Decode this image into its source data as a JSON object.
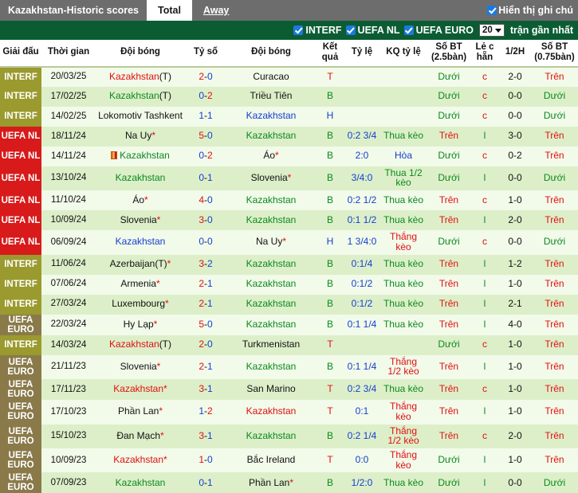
{
  "topbar": {
    "title_main": "Kazakhstan",
    "title_sep": " - ",
    "title_sub": "Historic scores",
    "tabs": [
      {
        "label": "Total",
        "active": true
      },
      {
        "label": "Away",
        "active": false
      }
    ],
    "show_notes_label": "Hiển thị ghi chú",
    "show_notes_checked": true
  },
  "filterbar": {
    "filters": [
      {
        "label": "INTERF",
        "checked": true
      },
      {
        "label": "UEFA NL",
        "checked": true
      },
      {
        "label": "UEFA EURO",
        "checked": true
      }
    ],
    "count_value": "20",
    "count_suffix": "trận gần nhất"
  },
  "columns": [
    "Giải đấu",
    "Thời gian",
    "Đội bóng",
    "Tỷ số",
    "Đội bóng",
    "Kết quả",
    "Tỷ lệ",
    "KQ tỷ lệ",
    "Số BT (2.5bàn)",
    "Lẻ c hẵn",
    "1/2H",
    "Số BT (0.75bàn)"
  ],
  "colors": {
    "interf_badge": "#9a9a2e",
    "uefa_nl_badge": "#d81a1a",
    "uefa_euro_badge": "#8a7a4a",
    "header_green": "#0b5c33",
    "topbar_gray": "#6d6d6d",
    "accent_blue": "#1a7ae0",
    "row_odd": "#f2faea",
    "row_even": "#ddefc9",
    "green_text": "#0a8a1e",
    "red_text": "#e01010",
    "blue_text": "#1540d0"
  },
  "rows": [
    {
      "league": "INTERF",
      "league_key": "interf",
      "time": "20/03/25",
      "home": "Kazakhstan",
      "home_color": "red",
      "home_suffix": "(T)",
      "home_card": false,
      "score_l": "2",
      "score_r": "0",
      "score_l_color": "red",
      "score_r_color": "blue",
      "away": "Curacao",
      "away_color": "dark",
      "away_star": false,
      "result": "T",
      "result_color": "red",
      "odds": "",
      "odds_result": "",
      "odds_result_color": "green",
      "bt25": "Dưới",
      "bt25_color": "green",
      "oddeven": "c",
      "oddeven_color": "red",
      "half": "2-0",
      "half_color": "dark",
      "bt075": "Trên",
      "bt075_color": "red"
    },
    {
      "league": "INTERF",
      "league_key": "interf",
      "time": "17/02/25",
      "home": "Kazakhstan",
      "home_color": "green",
      "home_suffix": "(T)",
      "home_card": false,
      "score_l": "0",
      "score_r": "2",
      "score_l_color": "blue",
      "score_r_color": "red",
      "away": "Triều Tiên",
      "away_color": "dark",
      "away_star": false,
      "result": "B",
      "result_color": "green",
      "odds": "",
      "odds_result": "",
      "odds_result_color": "green",
      "bt25": "Dưới",
      "bt25_color": "green",
      "oddeven": "c",
      "oddeven_color": "red",
      "half": "0-0",
      "half_color": "dark",
      "bt075": "Dưới",
      "bt075_color": "green"
    },
    {
      "league": "INTERF",
      "league_key": "interf",
      "time": "14/02/25",
      "home": "Lokomotiv Tashkent",
      "home_color": "dark",
      "home_suffix": "",
      "home_card": false,
      "score_l": "1",
      "score_r": "1",
      "score_l_color": "blue",
      "score_r_color": "blue",
      "away": "Kazakhstan",
      "away_color": "blue",
      "away_star": false,
      "result": "H",
      "result_color": "blue",
      "odds": "",
      "odds_result": "",
      "odds_result_color": "green",
      "bt25": "Dưới",
      "bt25_color": "green",
      "oddeven": "c",
      "oddeven_color": "red",
      "half": "0-0",
      "half_color": "dark",
      "bt075": "Dưới",
      "bt075_color": "green"
    },
    {
      "league": "UEFA NL",
      "league_key": "uefanl",
      "time": "18/11/24",
      "home": "Na Uy",
      "home_color": "dark",
      "home_suffix": "",
      "home_star": true,
      "home_card": false,
      "score_l": "5",
      "score_r": "0",
      "score_l_color": "red",
      "score_r_color": "blue",
      "away": "Kazakhstan",
      "away_color": "green",
      "away_star": false,
      "result": "B",
      "result_color": "green",
      "odds": "0:2 3/4",
      "odds_result": "Thua kèo",
      "odds_result_color": "green",
      "bt25": "Trên",
      "bt25_color": "red",
      "oddeven": "l",
      "oddeven_color": "green",
      "half": "3-0",
      "half_color": "dark",
      "bt075": "Trên",
      "bt075_color": "red"
    },
    {
      "league": "UEFA NL",
      "league_key": "uefanl",
      "time": "14/11/24",
      "home": "Kazakhstan",
      "home_color": "green",
      "home_suffix": "",
      "home_card": true,
      "score_l": "0",
      "score_r": "2",
      "score_l_color": "blue",
      "score_r_color": "red",
      "away": "Áo",
      "away_color": "dark",
      "away_star": true,
      "result": "B",
      "result_color": "green",
      "odds": "2:0",
      "odds_result": "Hòa",
      "odds_result_color": "blue",
      "bt25": "Dưới",
      "bt25_color": "green",
      "oddeven": "c",
      "oddeven_color": "red",
      "half": "0-2",
      "half_color": "dark",
      "bt075": "Trên",
      "bt075_color": "red"
    },
    {
      "league": "UEFA NL",
      "league_key": "uefanl",
      "time": "13/10/24",
      "home": "Kazakhstan",
      "home_color": "green",
      "home_suffix": "",
      "home_card": false,
      "score_l": "0",
      "score_r": "1",
      "score_l_color": "blue",
      "score_r_color": "blue",
      "away": "Slovenia",
      "away_color": "dark",
      "away_star": true,
      "result": "B",
      "result_color": "green",
      "odds": "3/4:0",
      "odds_result": "Thua 1/2 kèo",
      "odds_result_color": "green",
      "bt25": "Dưới",
      "bt25_color": "green",
      "oddeven": "l",
      "oddeven_color": "green",
      "half": "0-0",
      "half_color": "dark",
      "bt075": "Dưới",
      "bt075_color": "green"
    },
    {
      "league": "UEFA NL",
      "league_key": "uefanl",
      "time": "11/10/24",
      "home": "Áo",
      "home_color": "dark",
      "home_suffix": "",
      "home_star": true,
      "home_card": false,
      "score_l": "4",
      "score_r": "0",
      "score_l_color": "red",
      "score_r_color": "blue",
      "away": "Kazakhstan",
      "away_color": "green",
      "away_star": false,
      "result": "B",
      "result_color": "green",
      "odds": "0:2 1/2",
      "odds_result": "Thua kèo",
      "odds_result_color": "green",
      "bt25": "Trên",
      "bt25_color": "red",
      "oddeven": "c",
      "oddeven_color": "red",
      "half": "1-0",
      "half_color": "dark",
      "bt075": "Trên",
      "bt075_color": "red"
    },
    {
      "league": "UEFA NL",
      "league_key": "uefanl",
      "time": "10/09/24",
      "home": "Slovenia",
      "home_color": "dark",
      "home_suffix": "",
      "home_star": true,
      "home_card": false,
      "score_l": "3",
      "score_r": "0",
      "score_l_color": "red",
      "score_r_color": "blue",
      "away": "Kazakhstan",
      "away_color": "green",
      "away_star": false,
      "result": "B",
      "result_color": "green",
      "odds": "0:1 1/2",
      "odds_result": "Thua kèo",
      "odds_result_color": "green",
      "bt25": "Trên",
      "bt25_color": "red",
      "oddeven": "l",
      "oddeven_color": "green",
      "half": "2-0",
      "half_color": "dark",
      "bt075": "Trên",
      "bt075_color": "red"
    },
    {
      "league": "UEFA NL",
      "league_key": "uefanl",
      "time": "06/09/24",
      "home": "Kazakhstan",
      "home_color": "blue",
      "home_suffix": "",
      "home_card": false,
      "score_l": "0",
      "score_r": "0",
      "score_l_color": "blue",
      "score_r_color": "blue",
      "away": "Na Uy",
      "away_color": "dark",
      "away_star": true,
      "result": "H",
      "result_color": "blue",
      "odds": "1 3/4:0",
      "odds_result": "Thắng kèo",
      "odds_result_color": "red",
      "bt25": "Dưới",
      "bt25_color": "green",
      "oddeven": "c",
      "oddeven_color": "red",
      "half": "0-0",
      "half_color": "dark",
      "bt075": "Dưới",
      "bt075_color": "green"
    },
    {
      "league": "INTERF",
      "league_key": "interf",
      "time": "11/06/24",
      "home": "Azerbaijan",
      "home_color": "dark",
      "home_suffix": "(T)",
      "home_star": true,
      "home_card": false,
      "score_l": "3",
      "score_r": "2",
      "score_l_color": "red",
      "score_r_color": "blue",
      "away": "Kazakhstan",
      "away_color": "green",
      "away_star": false,
      "result": "B",
      "result_color": "green",
      "odds": "0:1/4",
      "odds_result": "Thua kèo",
      "odds_result_color": "green",
      "bt25": "Trên",
      "bt25_color": "red",
      "oddeven": "l",
      "oddeven_color": "green",
      "half": "1-2",
      "half_color": "dark",
      "bt075": "Trên",
      "bt075_color": "red"
    },
    {
      "league": "INTERF",
      "league_key": "interf",
      "time": "07/06/24",
      "home": "Armenia",
      "home_color": "dark",
      "home_suffix": "",
      "home_star": true,
      "home_card": false,
      "score_l": "2",
      "score_r": "1",
      "score_l_color": "red",
      "score_r_color": "blue",
      "away": "Kazakhstan",
      "away_color": "green",
      "away_star": false,
      "result": "B",
      "result_color": "green",
      "odds": "0:1/2",
      "odds_result": "Thua kèo",
      "odds_result_color": "green",
      "bt25": "Trên",
      "bt25_color": "red",
      "oddeven": "l",
      "oddeven_color": "green",
      "half": "1-0",
      "half_color": "dark",
      "bt075": "Trên",
      "bt075_color": "red"
    },
    {
      "league": "INTERF",
      "league_key": "interf",
      "time": "27/03/24",
      "home": "Luxembourg",
      "home_color": "dark",
      "home_suffix": "",
      "home_star": true,
      "home_card": false,
      "score_l": "2",
      "score_r": "1",
      "score_l_color": "red",
      "score_r_color": "blue",
      "away": "Kazakhstan",
      "away_color": "green",
      "away_star": false,
      "result": "B",
      "result_color": "green",
      "odds": "0:1/2",
      "odds_result": "Thua kèo",
      "odds_result_color": "green",
      "bt25": "Trên",
      "bt25_color": "red",
      "oddeven": "l",
      "oddeven_color": "green",
      "half": "2-1",
      "half_color": "dark",
      "bt075": "Trên",
      "bt075_color": "red"
    },
    {
      "league": "UEFA EURO",
      "league_key": "uefaeuro",
      "time": "22/03/24",
      "home": "Hy Lạp",
      "home_color": "dark",
      "home_suffix": "",
      "home_star": true,
      "home_card": false,
      "score_l": "5",
      "score_r": "0",
      "score_l_color": "red",
      "score_r_color": "blue",
      "away": "Kazakhstan",
      "away_color": "green",
      "away_star": false,
      "result": "B",
      "result_color": "green",
      "odds": "0:1 1/4",
      "odds_result": "Thua kèo",
      "odds_result_color": "green",
      "bt25": "Trên",
      "bt25_color": "red",
      "oddeven": "l",
      "oddeven_color": "green",
      "half": "4-0",
      "half_color": "dark",
      "bt075": "Trên",
      "bt075_color": "red"
    },
    {
      "league": "INTERF",
      "league_key": "interf",
      "time": "14/03/24",
      "home": "Kazakhstan",
      "home_color": "red",
      "home_suffix": "(T)",
      "home_card": false,
      "score_l": "2",
      "score_r": "0",
      "score_l_color": "red",
      "score_r_color": "blue",
      "away": "Turkmenistan",
      "away_color": "dark",
      "away_star": false,
      "result": "T",
      "result_color": "red",
      "odds": "",
      "odds_result": "",
      "odds_result_color": "green",
      "bt25": "Dưới",
      "bt25_color": "green",
      "oddeven": "c",
      "oddeven_color": "red",
      "half": "1-0",
      "half_color": "dark",
      "bt075": "Trên",
      "bt075_color": "red"
    },
    {
      "league": "UEFA EURO",
      "league_key": "uefaeuro",
      "time": "21/11/23",
      "home": "Slovenia",
      "home_color": "dark",
      "home_suffix": "",
      "home_star": true,
      "home_card": false,
      "score_l": "2",
      "score_r": "1",
      "score_l_color": "red",
      "score_r_color": "blue",
      "away": "Kazakhstan",
      "away_color": "green",
      "away_star": false,
      "result": "B",
      "result_color": "green",
      "odds": "0:1 1/4",
      "odds_result": "Thắng 1/2 kèo",
      "odds_result_color": "red",
      "bt25": "Trên",
      "bt25_color": "red",
      "oddeven": "l",
      "oddeven_color": "green",
      "half": "1-0",
      "half_color": "dark",
      "bt075": "Trên",
      "bt075_color": "red"
    },
    {
      "league": "UEFA EURO",
      "league_key": "uefaeuro",
      "time": "17/11/23",
      "home": "Kazakhstan",
      "home_color": "red",
      "home_suffix": "",
      "home_star": true,
      "home_card": false,
      "score_l": "3",
      "score_r": "1",
      "score_l_color": "red",
      "score_r_color": "blue",
      "away": "San Marino",
      "away_color": "dark",
      "away_star": false,
      "result": "T",
      "result_color": "red",
      "odds": "0:2 3/4",
      "odds_result": "Thua kèo",
      "odds_result_color": "green",
      "bt25": "Trên",
      "bt25_color": "red",
      "oddeven": "c",
      "oddeven_color": "red",
      "half": "1-0",
      "half_color": "dark",
      "bt075": "Trên",
      "bt075_color": "red"
    },
    {
      "league": "UEFA EURO",
      "league_key": "uefaeuro",
      "time": "17/10/23",
      "home": "Phần Lan",
      "home_color": "dark",
      "home_suffix": "",
      "home_star": true,
      "home_card": false,
      "score_l": "1",
      "score_r": "2",
      "score_l_color": "blue",
      "score_r_color": "red",
      "away": "Kazakhstan",
      "away_color": "red",
      "away_star": false,
      "result": "T",
      "result_color": "red",
      "odds": "0:1",
      "odds_result": "Thắng kèo",
      "odds_result_color": "red",
      "bt25": "Trên",
      "bt25_color": "red",
      "oddeven": "l",
      "oddeven_color": "green",
      "half": "1-0",
      "half_color": "dark",
      "bt075": "Trên",
      "bt075_color": "red"
    },
    {
      "league": "UEFA EURO",
      "league_key": "uefaeuro",
      "time": "15/10/23",
      "home": "Đan Mạch",
      "home_color": "dark",
      "home_suffix": "",
      "home_star": true,
      "home_card": false,
      "score_l": "3",
      "score_r": "1",
      "score_l_color": "red",
      "score_r_color": "blue",
      "away": "Kazakhstan",
      "away_color": "green",
      "away_star": false,
      "result": "B",
      "result_color": "green",
      "odds": "0:2 1/4",
      "odds_result": "Thắng 1/2 kèo",
      "odds_result_color": "red",
      "bt25": "Trên",
      "bt25_color": "red",
      "oddeven": "c",
      "oddeven_color": "red",
      "half": "2-0",
      "half_color": "dark",
      "bt075": "Trên",
      "bt075_color": "red"
    },
    {
      "league": "UEFA EURO",
      "league_key": "uefaeuro",
      "time": "10/09/23",
      "home": "Kazakhstan",
      "home_color": "red",
      "home_suffix": "",
      "home_star": true,
      "home_card": false,
      "score_l": "1",
      "score_r": "0",
      "score_l_color": "red",
      "score_r_color": "blue",
      "away": "Bắc Ireland",
      "away_color": "dark",
      "away_star": false,
      "result": "T",
      "result_color": "red",
      "odds": "0:0",
      "odds_result": "Thắng kèo",
      "odds_result_color": "red",
      "bt25": "Dưới",
      "bt25_color": "green",
      "oddeven": "l",
      "oddeven_color": "green",
      "half": "1-0",
      "half_color": "dark",
      "bt075": "Trên",
      "bt075_color": "red"
    },
    {
      "league": "UEFA EURO",
      "league_key": "uefaeuro",
      "time": "07/09/23",
      "home": "Kazakhstan",
      "home_color": "green",
      "home_suffix": "",
      "home_card": false,
      "score_l": "0",
      "score_r": "1",
      "score_l_color": "blue",
      "score_r_color": "blue",
      "away": "Phần Lan",
      "away_color": "dark",
      "away_star": true,
      "result": "B",
      "result_color": "green",
      "odds": "1/2:0",
      "odds_result": "Thua kèo",
      "odds_result_color": "green",
      "bt25": "Dưới",
      "bt25_color": "green",
      "oddeven": "l",
      "oddeven_color": "green",
      "half": "0-0",
      "half_color": "dark",
      "bt075": "Dưới",
      "bt075_color": "green"
    }
  ]
}
